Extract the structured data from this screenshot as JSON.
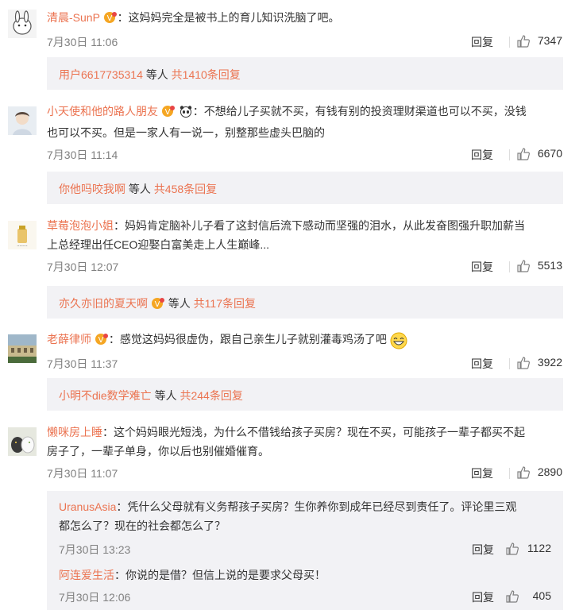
{
  "actions": {
    "reply": "回复"
  },
  "colors": {
    "username": "#eb7350",
    "meta": "#808080",
    "subbox_bg": "#f2f2f5"
  },
  "comments": [
    {
      "user": "清晨-SunP",
      "text": "：这妈妈完全是被书上的育儿知识洗脑了吧。",
      "time": "7月30日 11:06",
      "likes": "7347",
      "replies_summary": {
        "users": "用户6617735314",
        "mid": " 等人 ",
        "count": "共1410条回复"
      }
    },
    {
      "user": "小天使和他的路人朋友",
      "text_line1": "：不想给儿子买就不买，有钱有别的投资理财渠道也可以不买，没钱",
      "text_line2": "也可以不买。但是一家人有一说一，别整那些虚头巴脑的",
      "time": "7月30日 11:14",
      "likes": "6670",
      "replies_summary": {
        "users": "你他吗咬我啊",
        "mid": " 等人 ",
        "count": "共458条回复"
      }
    },
    {
      "user": "草莓泡泡小姐",
      "text_line1": "：妈妈肯定脑补儿子看了这封信后流下感动而坚强的泪水，从此发奋图强升职加薪当",
      "text_line2": "上总经理出任CEO迎娶白富美走上人生巅峰...",
      "time": "7月30日 12:07",
      "likes": "5513",
      "replies_summary": {
        "users": "亦久亦旧的夏天啊",
        "mid": " 等人 ",
        "count": "共117条回复"
      }
    },
    {
      "user": "老薛律师",
      "text": "：感觉这妈妈很虚伪，跟自己亲生儿子就别灌毒鸡汤了吧",
      "time": "7月30日 11:37",
      "likes": "3922",
      "replies_summary": {
        "users": "小明不die数学难亡",
        "mid": " 等人 ",
        "count": "共244条回复"
      }
    },
    {
      "user": "懒咪房上睡",
      "text_line1": "：这个妈妈眼光短浅，为什么不借钱给孩子买房？现在不买，可能孩子一辈子都买不起",
      "text_line2": "房子了，一辈子单身，你以后也别催婚催育。",
      "time": "7月30日 11:07",
      "likes": "2890",
      "sub_replies": [
        {
          "user": "UranusAsia",
          "text_line1": "：凭什么父母就有义务帮孩子买房？生你养你到成年已经尽到责任了。评论里三观",
          "text_line2": "都怎么了？现在的社会都怎么了？",
          "time": "7月30日 13:23",
          "likes": "1122"
        },
        {
          "user": "阿连爱生活",
          "text": "：你说的是借？但信上说的是要求父母买！",
          "time": "7月30日 12:06",
          "likes": "405"
        }
      ]
    }
  ]
}
